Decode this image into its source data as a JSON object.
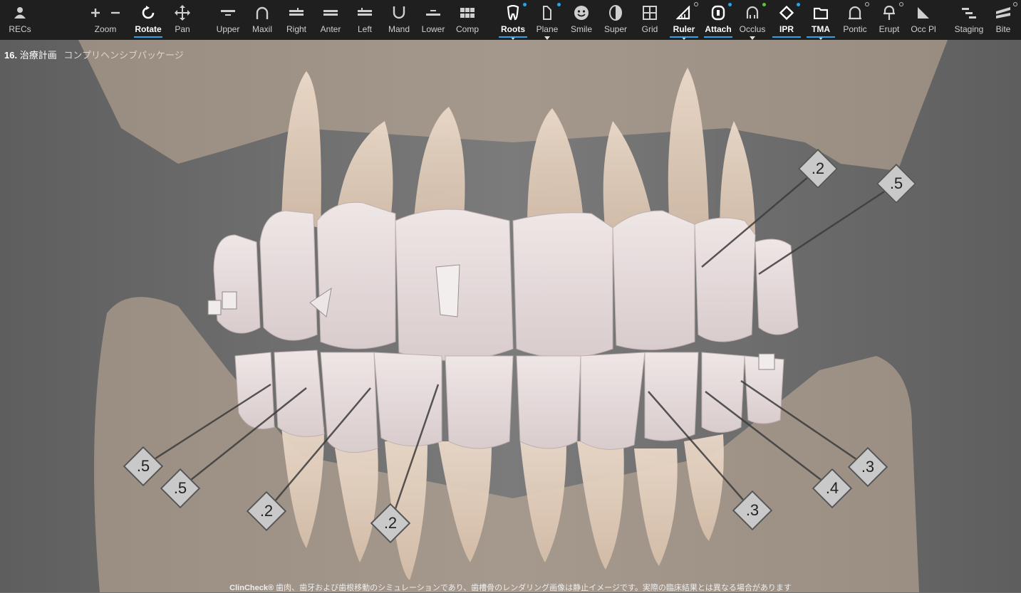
{
  "toolbar": {
    "items": [
      {
        "label": "RECs",
        "icon": "person-icon"
      },
      {
        "label": "Zoom",
        "icon": "zoom-plus-minus-icon"
      },
      {
        "label": "Rotate",
        "icon": "rotate-icon",
        "active": true
      },
      {
        "label": "Pan",
        "icon": "pan-arrows-icon"
      },
      {
        "label": "Upper",
        "icon": "upper-view-icon"
      },
      {
        "label": "Maxil",
        "icon": "maxillary-arch-icon"
      },
      {
        "label": "Right",
        "icon": "right-view-icon"
      },
      {
        "label": "Anter",
        "icon": "anterior-view-icon"
      },
      {
        "label": "Left",
        "icon": "left-view-icon"
      },
      {
        "label": "Mand",
        "icon": "mandibular-arch-icon"
      },
      {
        "label": "Lower",
        "icon": "lower-view-icon"
      },
      {
        "label": "Comp",
        "icon": "compare-grid-icon"
      },
      {
        "label": "Roots",
        "icon": "tooth-root-icon",
        "active": true
      },
      {
        "label": "Plane",
        "icon": "plane-icon"
      },
      {
        "label": "Smile",
        "icon": "smile-face-icon"
      },
      {
        "label": "Super",
        "icon": "superimpose-icon"
      },
      {
        "label": "Grid",
        "icon": "grid-icon"
      },
      {
        "label": "Ruler",
        "icon": "ruler-triangle-icon",
        "active": true
      },
      {
        "label": "Attach",
        "icon": "attachment-icon",
        "active": true
      },
      {
        "label": "Occlus",
        "icon": "occlusion-icon"
      },
      {
        "label": "IPR",
        "icon": "ipr-diamond-icon",
        "active": true
      },
      {
        "label": "TMA",
        "icon": "folder-icon",
        "active": true
      },
      {
        "label": "Pontic",
        "icon": "pontic-icon"
      },
      {
        "label": "Erupt",
        "icon": "eruption-icon"
      },
      {
        "label": "Occ Pl",
        "icon": "occlusal-plane-icon"
      },
      {
        "label": "Staging",
        "icon": "staging-icon"
      },
      {
        "label": "Bite",
        "icon": "bite-icon"
      }
    ]
  },
  "stage": {
    "number": "16.",
    "title": "治療計画",
    "package": "コンプリヘンシブパッケージ"
  },
  "ipr_labels": [
    ".2",
    ".5",
    ".5",
    ".5",
    ".2",
    ".2",
    ".3",
    ".4",
    ".3"
  ],
  "footer": {
    "brand": "ClinCheck®",
    "text": " 歯肉、歯牙および歯根移動のシミュレーションであり、歯槽骨のレンダリング画像は静止イメージです。実際の臨床結果とは異なる場合があります"
  },
  "colors": {
    "toolbar_bg": "#1f1f1f",
    "accent": "#2aa4e8",
    "status_green": "#5ec43a",
    "background": "#6f6f6f"
  }
}
